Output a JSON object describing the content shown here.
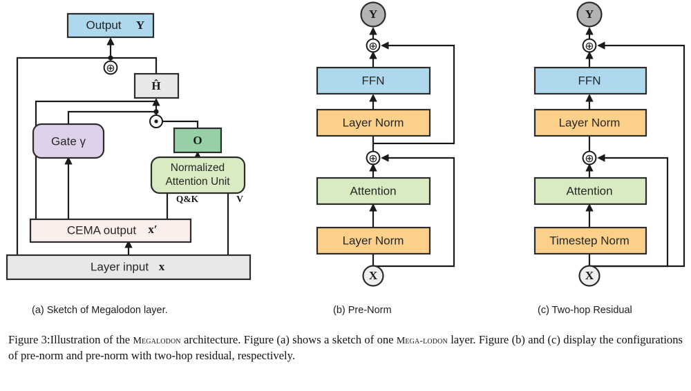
{
  "figure": {
    "number": "Figure 3:",
    "caption_part1": "Illustration of the ",
    "caption_brand1": "Megalodon",
    "caption_part2": " architecture. Figure (a) shows a sketch of one ",
    "caption_brand2": "Mega-",
    "caption_brand3": "lodon",
    "caption_part3": " layer. Figure (b) and (c) display the configurations of pre-norm and pre-norm with two-hop residual, respectively."
  },
  "subcaptions": {
    "a": "(a) Sketch of Megalodon layer.",
    "b": "(b) Pre-Norm",
    "c": "(c) Two-hop Residual"
  },
  "colors": {
    "blue": "#add8ee",
    "orange": "#fbd08a",
    "green_light": "#d9ebc0",
    "green_dark": "#97cfa6",
    "purple": "#ddd2ea",
    "pink": "#fceeea",
    "gray": "#e8e8e8",
    "gray_dark": "#b3b3b3",
    "stroke": "#2b2b2b"
  },
  "panel_a": {
    "title": "Sketch of Megalodon layer",
    "boxes": [
      {
        "id": "output-y",
        "label_text": "Output",
        "label_math": "Y",
        "fill": "blue"
      },
      {
        "id": "h-hat",
        "label_math": "Ĥ",
        "fill": "gray"
      },
      {
        "id": "gate",
        "label_text": "Gate γ",
        "fill": "purple"
      },
      {
        "id": "o-box",
        "label_math": "O",
        "fill": "green_dark"
      },
      {
        "id": "nau",
        "label_line1": "Normalized",
        "label_line2": "Attention Unit",
        "fill": "green_light"
      },
      {
        "id": "cema",
        "label_text": "CEMA output",
        "label_math": "x′",
        "fill": "pink"
      },
      {
        "id": "layer-input",
        "label_text": "Layer input",
        "label_math": "x",
        "fill": "gray"
      }
    ],
    "edge_labels": {
      "qk": "Q&K",
      "v": "V"
    },
    "operators": {
      "add": "⊕",
      "hadamard": "⊙"
    }
  },
  "panel_b": {
    "title": "Pre-Norm",
    "terminal_top": "Y",
    "terminal_bottom": "X",
    "blocks": [
      {
        "label": "FFN",
        "fill": "blue"
      },
      {
        "label": "Layer Norm",
        "fill": "orange"
      },
      {
        "label": "Attention",
        "fill": "green_light"
      },
      {
        "label": "Layer Norm",
        "fill": "orange"
      }
    ],
    "operator": "⊕"
  },
  "panel_c": {
    "title": "Two-hop Residual",
    "terminal_top": "Y",
    "terminal_bottom": "X",
    "blocks": [
      {
        "label": "FFN",
        "fill": "blue"
      },
      {
        "label": "Layer Norm",
        "fill": "orange"
      },
      {
        "label": "Attention",
        "fill": "green_light"
      },
      {
        "label": "Timestep Norm",
        "fill": "orange"
      }
    ],
    "operator": "⊕"
  }
}
